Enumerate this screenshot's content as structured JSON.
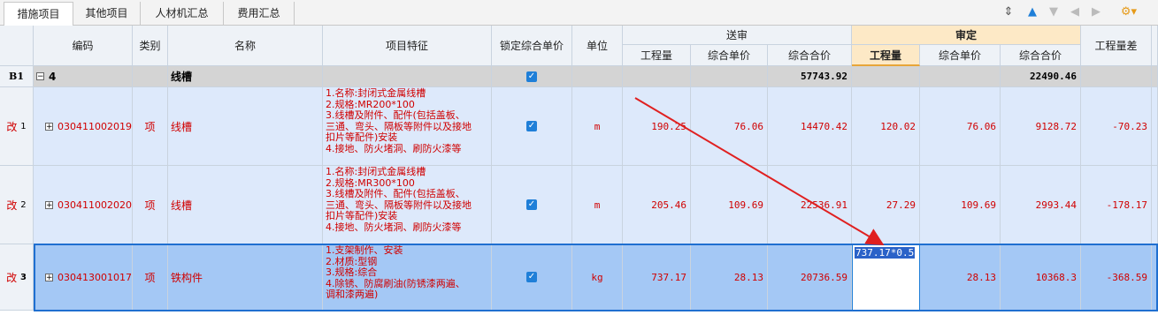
{
  "tabs": [
    "措施项目",
    "其他项目",
    "人材机汇总",
    "费用汇总"
  ],
  "toolbar": {
    "icons": [
      "expand-collapse-icon",
      "move-up-icon",
      "move-down-icon",
      "move-left-icon",
      "move-right-icon",
      "settings-dropdown-icon"
    ]
  },
  "headers": {
    "code": "编码",
    "category": "类别",
    "name": "名称",
    "features": "项目特征",
    "lock_price": "锁定综合单价",
    "unit": "单位",
    "submit_group": "送审",
    "audit_group": "审定",
    "qty": "工程量",
    "unit_price": "综合单价",
    "total": "综合合价",
    "qty_diff": "工程量差"
  },
  "group_row": {
    "row_label": "B1",
    "collapse_symbol": "−",
    "code": "4",
    "name": "线槽",
    "submit_total": "57743.92",
    "audit_total": "22490.46"
  },
  "rows": [
    {
      "status": "改",
      "index": "1",
      "expand_symbol": "+",
      "code": "030411002019",
      "category": "项",
      "name": "线槽",
      "features": [
        "1.名称:封闭式金属线槽",
        "2.规格:MR200*100",
        "3.线槽及附件、配件(包括盖板、",
        "三通、弯头、隔板等附件以及接地",
        "扣片等配件)安装",
        "4.接地、防火堵洞、刷防火漆等"
      ],
      "unit": "m",
      "submit_qty": "190.25",
      "submit_price": "76.06",
      "submit_total": "14470.42",
      "audit_qty": "120.02",
      "audit_price": "76.06",
      "audit_total": "9128.72",
      "qty_diff": "-70.23"
    },
    {
      "status": "改",
      "index": "2",
      "expand_symbol": "+",
      "code": "030411002020",
      "category": "项",
      "name": "线槽",
      "features": [
        "1.名称:封闭式金属线槽",
        "2.规格:MR300*100",
        "3.线槽及附件、配件(包括盖板、",
        "三通、弯头、隔板等附件以及接地",
        "扣片等配件)安装",
        "4.接地、防火堵洞、刷防火漆等"
      ],
      "unit": "m",
      "submit_qty": "205.46",
      "submit_price": "109.69",
      "submit_total": "22536.91",
      "audit_qty": "27.29",
      "audit_price": "109.69",
      "audit_total": "2993.44",
      "qty_diff": "-178.17"
    },
    {
      "status": "改",
      "index": "3",
      "expand_symbol": "+",
      "code": "030413001017",
      "category": "项",
      "name": "铁构件",
      "features": [
        "1.支架制作、安装",
        "2.材质:型钢",
        "3.规格:综合",
        "4.除锈、防腐刷油(防锈漆两遍、",
        "调和漆两遍)"
      ],
      "unit": "kg",
      "submit_qty": "737.17",
      "submit_price": "28.13",
      "submit_total": "20736.59",
      "audit_qty_editing": "737.17*0.5",
      "audit_price": "28.13",
      "audit_total": "10368.3",
      "qty_diff": "-368.59"
    }
  ],
  "colors": {
    "header_bg": "#eef2f7",
    "audit_header_bg": "#fde9c6",
    "group_row_bg": "#d4d4d4",
    "row_bg": "#dde9fb",
    "selected_row_bg": "#a4c8f5",
    "text_red": "#d00000",
    "accent_blue": "#1f7fd8",
    "arrow_red": "#e02020"
  }
}
